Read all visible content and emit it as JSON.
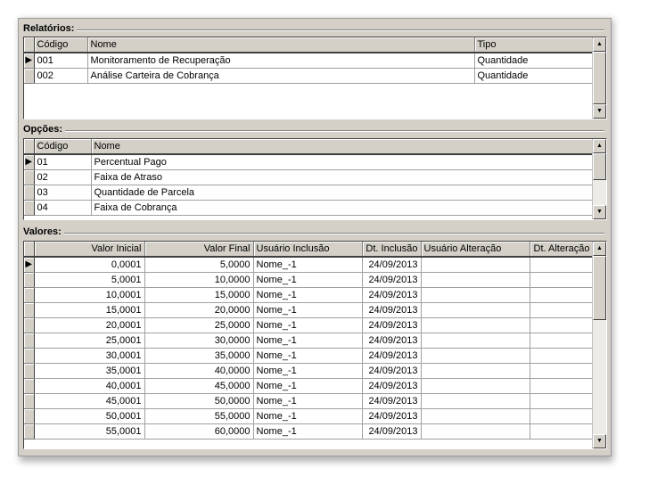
{
  "relatorios": {
    "title": "Relatórios:",
    "columns": [
      "Código",
      "Nome",
      "Tipo"
    ],
    "rows": [
      {
        "codigo": "001",
        "nome": "Monitoramento de Recuperação",
        "tipo": "Quantidade"
      },
      {
        "codigo": "002",
        "nome": "Análise Carteira de Cobrança",
        "tipo": "Quantidade"
      }
    ]
  },
  "opcoes": {
    "title": "Opções:",
    "columns": [
      "Código",
      "Nome"
    ],
    "rows": [
      {
        "codigo": "01",
        "nome": "Percentual Pago"
      },
      {
        "codigo": "02",
        "nome": "Faixa de Atraso"
      },
      {
        "codigo": "03",
        "nome": "Quantidade de Parcela"
      },
      {
        "codigo": "04",
        "nome": "Faixa de Cobrança"
      }
    ]
  },
  "valores": {
    "title": "Valores:",
    "columns": [
      "Valor Inicial",
      "Valor Final",
      "Usuário Inclusão",
      "Dt. Inclusão",
      "Usuário Alteração",
      "Dt. Alteração"
    ],
    "rows": [
      {
        "vi": "0,0001",
        "vf": "5,0000",
        "ui": "Nome_-1",
        "di": "24/09/2013",
        "ua": "",
        "da": ""
      },
      {
        "vi": "5,0001",
        "vf": "10,0000",
        "ui": "Nome_-1",
        "di": "24/09/2013",
        "ua": "",
        "da": ""
      },
      {
        "vi": "10,0001",
        "vf": "15,0000",
        "ui": "Nome_-1",
        "di": "24/09/2013",
        "ua": "",
        "da": ""
      },
      {
        "vi": "15,0001",
        "vf": "20,0000",
        "ui": "Nome_-1",
        "di": "24/09/2013",
        "ua": "",
        "da": ""
      },
      {
        "vi": "20,0001",
        "vf": "25,0000",
        "ui": "Nome_-1",
        "di": "24/09/2013",
        "ua": "",
        "da": ""
      },
      {
        "vi": "25,0001",
        "vf": "30,0000",
        "ui": "Nome_-1",
        "di": "24/09/2013",
        "ua": "",
        "da": ""
      },
      {
        "vi": "30,0001",
        "vf": "35,0000",
        "ui": "Nome_-1",
        "di": "24/09/2013",
        "ua": "",
        "da": ""
      },
      {
        "vi": "35,0001",
        "vf": "40,0000",
        "ui": "Nome_-1",
        "di": "24/09/2013",
        "ua": "",
        "da": ""
      },
      {
        "vi": "40,0001",
        "vf": "45,0000",
        "ui": "Nome_-1",
        "di": "24/09/2013",
        "ua": "",
        "da": ""
      },
      {
        "vi": "45,0001",
        "vf": "50,0000",
        "ui": "Nome_-1",
        "di": "24/09/2013",
        "ua": "",
        "da": ""
      },
      {
        "vi": "50,0001",
        "vf": "55,0000",
        "ui": "Nome_-1",
        "di": "24/09/2013",
        "ua": "",
        "da": ""
      },
      {
        "vi": "55,0001",
        "vf": "60,0000",
        "ui": "Nome_-1",
        "di": "24/09/2013",
        "ua": "",
        "da": ""
      }
    ]
  },
  "icons": {
    "row_indicator": "current-row-arrow-icon",
    "scroll_up": "scroll-up-arrow-icon",
    "scroll_down": "scroll-down-arrow-icon"
  }
}
